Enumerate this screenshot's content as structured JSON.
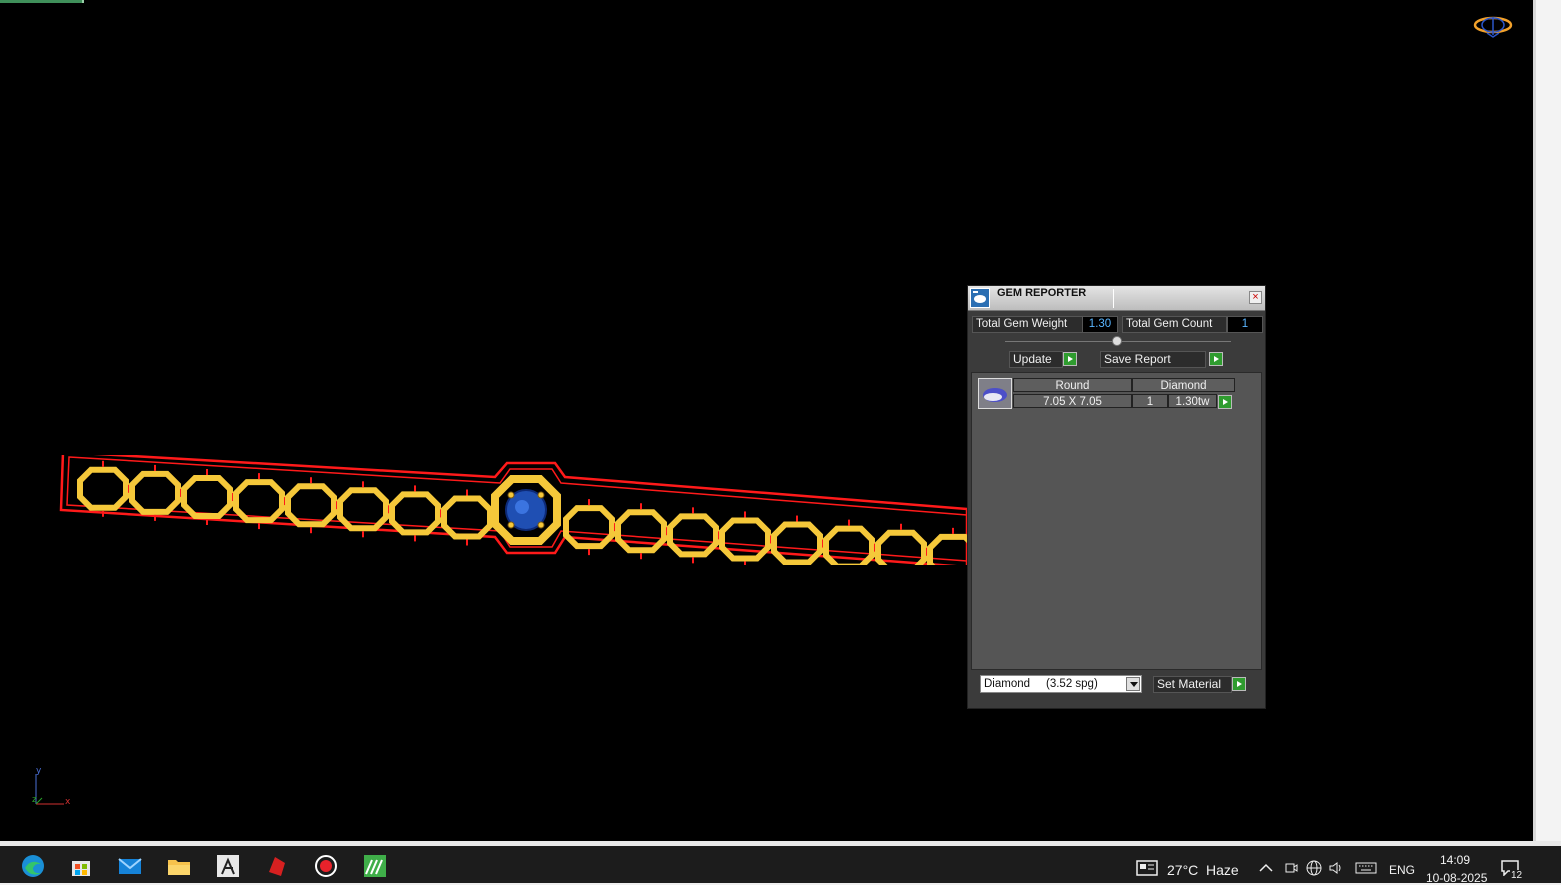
{
  "gem_reporter": {
    "title": "GEM REPORTER",
    "total_gem_weight_label": "Total Gem Weight",
    "total_gem_weight_value": "1.30",
    "total_gem_count_label": "Total Gem Count",
    "total_gem_count_value": "1",
    "update_label": "Update",
    "save_report_label": "Save Report",
    "rows": [
      {
        "shape": "Round",
        "material": "Diamond",
        "size": "7.05 X 7.05",
        "count": "1",
        "weight": "1.30tw"
      }
    ],
    "material_select_value": "Diamond     (3.52 spg)",
    "set_material_label": "Set Material"
  },
  "viewport": {
    "axis_labels": {
      "y": "y",
      "z": "z",
      "x": "x"
    },
    "colors": {
      "background": "#000000",
      "outline": "#ff1a1a",
      "metal": "#f5c83a",
      "gem": "#1f4fb3"
    }
  },
  "taskbar": {
    "weather_temp": "27°C",
    "weather_desc": "Haze",
    "language": "ENG",
    "time": "14:09",
    "date": "10-08-2025",
    "notification_count": "12"
  }
}
